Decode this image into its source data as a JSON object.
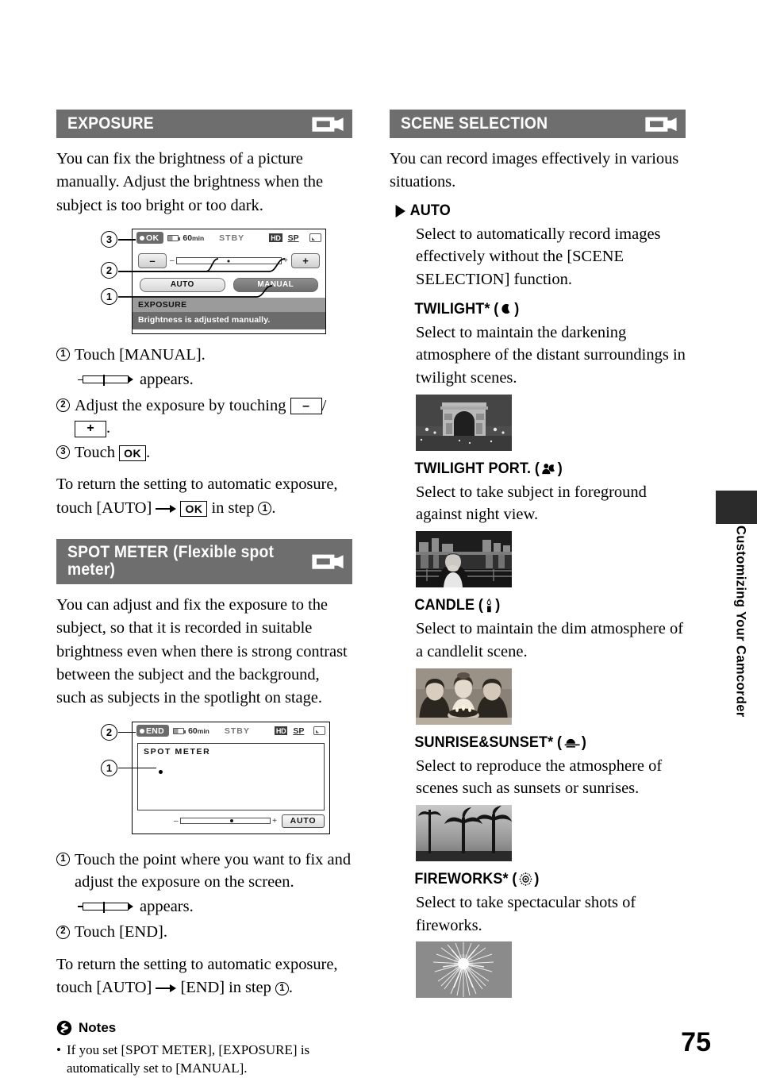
{
  "page": {
    "number": "75",
    "side_tab": "Customizing Your Camcorder"
  },
  "left_column": {
    "exposure": {
      "heading": "EXPOSURE",
      "header_icon": "camcorder-icon",
      "intro": "You can fix the brightness of a picture manually. Adjust the brightness when the subject is too bright or too dark.",
      "screen": {
        "status": {
          "ok_button": "OK",
          "battery_time": "60",
          "battery_unit": "min",
          "record_state": "STBY",
          "quality_hd": "HD",
          "quality_mode": "SP",
          "media_icon": "media-icon"
        },
        "minus_button": "–",
        "plus_button": "+",
        "slider_minus": "–",
        "slider_plus": "+",
        "auto_button": "AUTO",
        "manual_button": "MANUAL",
        "label_band": "EXPOSURE",
        "desc_band": "Brightness is adjusted manually."
      },
      "callouts": [
        "3",
        "2",
        "1"
      ],
      "steps": [
        {
          "num": "1",
          "text": "Touch [MANUAL]."
        },
        {
          "num": "2",
          "text": "Adjust the exposure by touching"
        },
        {
          "num": "3",
          "text": "Touch"
        }
      ],
      "appears_text": "appears.",
      "step2_key_minus": "–",
      "step2_key_plus": "+",
      "step2_separator": "/",
      "step2_period": ".",
      "step3_key_ok": "OK",
      "step3_period": ".",
      "return_text_before": "To return the setting to automatic exposure, touch [AUTO]",
      "return_key_ok": "OK",
      "return_text_mid": "in step",
      "return_step_num": "1",
      "return_text_end": "."
    },
    "spot_meter": {
      "heading": "SPOT METER (Flexible spot meter)",
      "header_icon": "camcorder-icon",
      "intro": "You can adjust and fix the exposure to the subject, so that it is recorded in suitable brightness even when there is strong contrast between the subject and the background, such as subjects in the spotlight on stage.",
      "screen": {
        "status": {
          "end_button": "END",
          "battery_time": "60",
          "battery_unit": "min",
          "record_state": "STBY",
          "quality_hd": "HD",
          "quality_mode": "SP",
          "media_icon": "media-icon"
        },
        "area_title": "SPOT METER",
        "slider_minus": "–",
        "slider_plus": "+",
        "auto_button": "AUTO"
      },
      "callouts": [
        "2",
        "1"
      ],
      "steps": [
        {
          "num": "1",
          "text": "Touch the point where you want to fix and adjust the exposure on the screen."
        },
        {
          "num": "2",
          "text": "Touch [END]."
        }
      ],
      "appears_text": "appears.",
      "return_text_before": "To return the setting to automatic exposure, touch [AUTO]",
      "return_text_mid": "[END] in step",
      "return_step_num": "1",
      "return_text_end": "."
    },
    "notes": {
      "icon": "notes-bolt-icon",
      "title": "Notes",
      "items": [
        "If you set [SPOT METER], [EXPOSURE] is automatically set to [MANUAL]."
      ]
    }
  },
  "right_column": {
    "scene_selection": {
      "heading": "SCENE SELECTION",
      "header_icon": "camcorder-icon",
      "intro": "You can record images effectively in various situations.",
      "items": [
        {
          "name": "AUTO",
          "marker": "triangle-default-marker",
          "icon": "",
          "icon_name": "",
          "star": "",
          "description": "Select to automatically record images effectively without the [SCENE SELECTION] function.",
          "photo": ""
        },
        {
          "name": "TWILIGHT",
          "marker": "",
          "icon": "moon-icon",
          "icon_name": "moon-icon",
          "star": "*",
          "description": "Select to maintain the darkening atmosphere of the distant surroundings in twilight scenes.",
          "photo": "arch-at-night-photo"
        },
        {
          "name": "TWILIGHT PORT.",
          "marker": "",
          "icon": "person-moon-icon",
          "icon_name": "person-moon-icon",
          "star": "",
          "description": "Select to take subject in foreground against night view.",
          "photo": "portrait-night-city-photo"
        },
        {
          "name": "CANDLE",
          "marker": "",
          "icon": "candle-icon",
          "icon_name": "candle-icon",
          "star": "",
          "description": "Select to maintain the dim atmosphere of a candlelit scene.",
          "photo": "children-birthday-cake-photo"
        },
        {
          "name": "SUNRISE&SUNSET",
          "marker": "",
          "icon": "sun-horizon-icon",
          "icon_name": "sun-horizon-icon",
          "star": "*",
          "description": "Select to reproduce the atmosphere of scenes such as sunsets or sunrises.",
          "photo": "palm-trees-sunset-photo"
        },
        {
          "name": "FIREWORKS",
          "marker": "",
          "icon": "fireworks-icon",
          "icon_name": "fireworks-icon",
          "star": "*",
          "description": "Select to take spectacular shots of fireworks.",
          "photo": "fireworks-burst-photo"
        }
      ]
    }
  },
  "colors": {
    "header_bar": "#6e6e6e",
    "label_band": "#9b9b9b",
    "desc_band": "#6b6b6b",
    "side_block": "#2b2b2b"
  }
}
